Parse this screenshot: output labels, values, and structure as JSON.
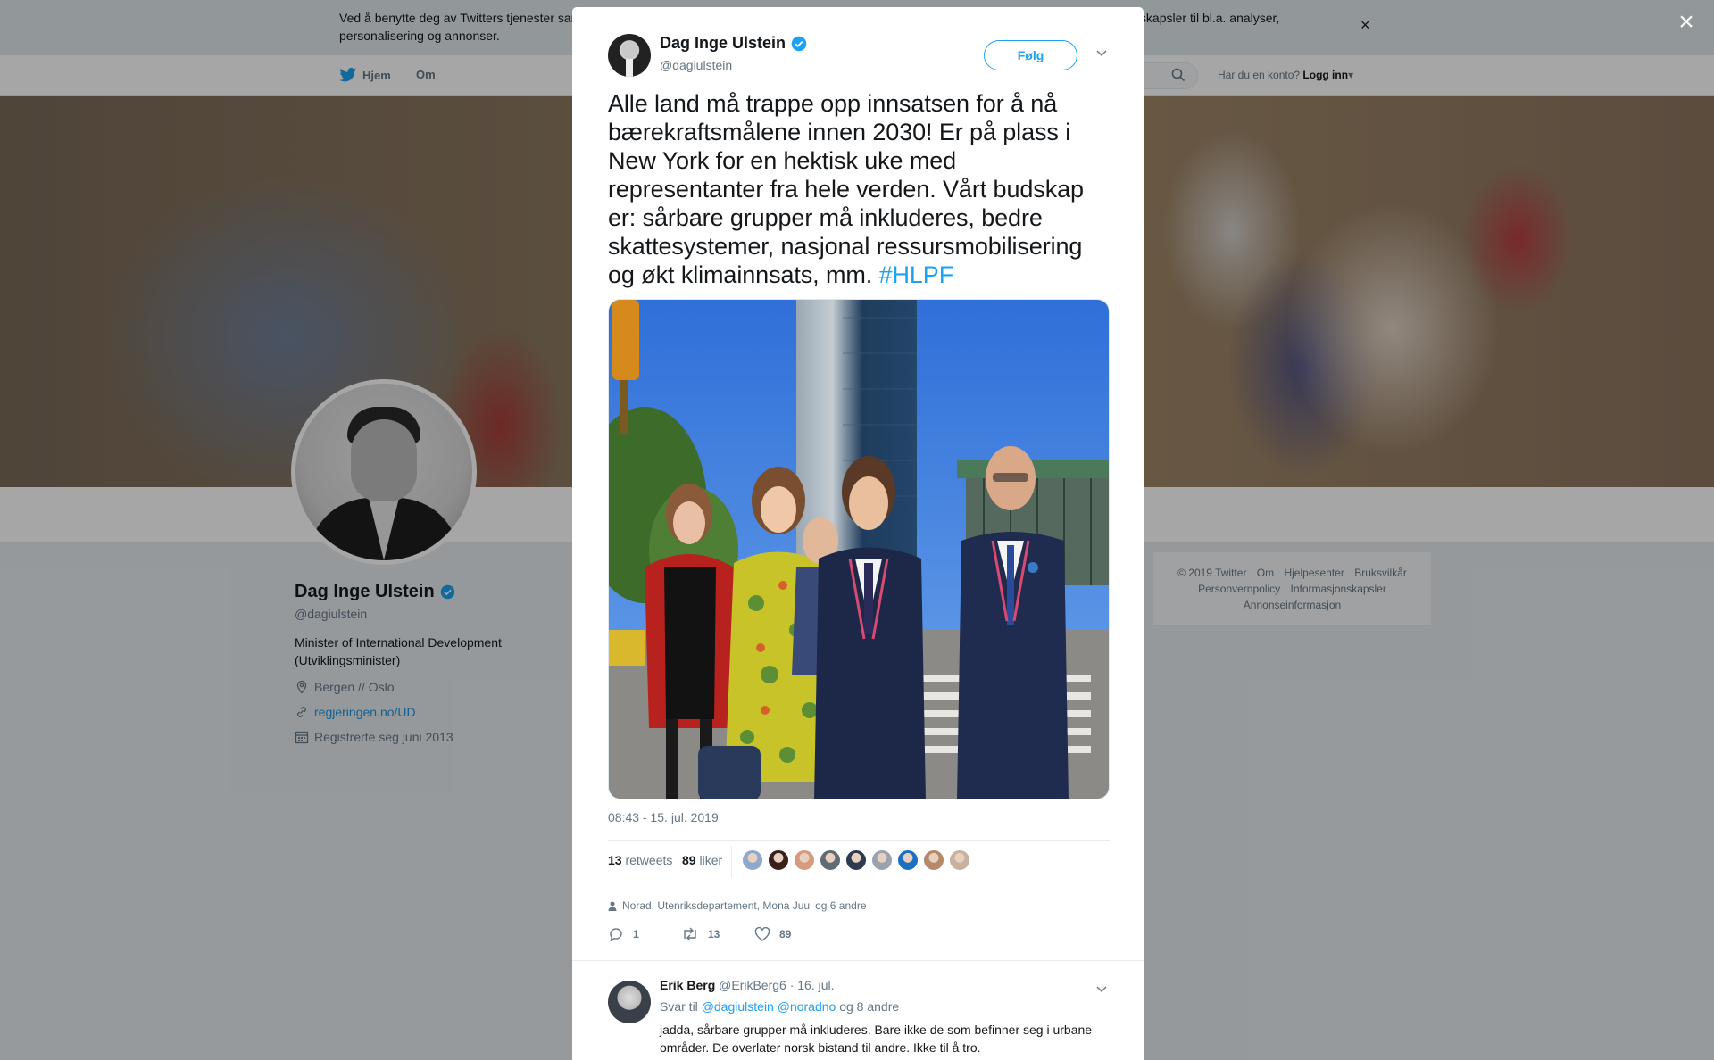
{
  "cookie_banner": {
    "text": "Ved å benytte deg av Twitters tjenester samtykker du til vår bruk av informasjonskapsler og at vi samler inn og bruker informasjon fra informasjonskapsler til bl.a. analyser, personalisering og annonser.",
    "close_glyph": "×"
  },
  "nav": {
    "home_label": "Hjem",
    "about_label": "Om",
    "account_prompt": "Har du en konto?",
    "login_label": "Logg inn"
  },
  "profile": {
    "name": "Dag Inge Ulstein",
    "handle": "@dagiulstein",
    "bio": "Minister of International Development (Utviklingsminister)",
    "location": "Bergen // Oslo",
    "link": "regjeringen.no/UD",
    "joined": "Registrerte seg juni 2013"
  },
  "footer": {
    "links": [
      "© 2019 Twitter",
      "Om",
      "Hjelpesenter",
      "Bruksvilkår",
      "Personvernpolicy",
      "Informasjonskapsler",
      "Annonseinformasjon"
    ]
  },
  "overlay": {
    "close_glyph": "×"
  },
  "tweet": {
    "author_name": "Dag Inge Ulstein",
    "author_handle": "@dagiulstein",
    "follow_label": "Følg",
    "text": "Alle land må trappe opp innsatsen for å nå bærekraftsmålene innen 2030! Er på plass i New York for en hektisk uke med representanter fra hele verden. Vårt budskap er: sårbare grupper må inkluderes, bedre skattesystemer, nasjonal ressursmobilisering og økt klimainnsats, mm.",
    "hashtag": "#HLPF",
    "timestamp": "08:43 - 15. jul. 2019",
    "retweets_count": "13",
    "retweets_label": "retweets",
    "likes_count": "89",
    "likes_label": "liker",
    "liked_by": "Norad, Utenriksdepartement, Mona Juul og 6 andre",
    "actions": {
      "reply_count": "1",
      "retweet_count": "13",
      "like_count": "89"
    },
    "liker_colors": [
      "#8ea9c9",
      "#3b1f1a",
      "#d79a7e",
      "#5f6b75",
      "#2d3b4e",
      "#9aa3ad",
      "#1d6fc2",
      "#b48a6a",
      "#c7b2a0"
    ]
  },
  "reply": {
    "name": "Erik Berg",
    "handle": "@ErikBerg6",
    "date": "· 16. jul.",
    "reply_prefix": "Svar til",
    "mention_1": "@dagiulstein",
    "mention_2": "@noradno",
    "reply_suffix": "og 8 andre",
    "text": "jadda, sårbare grupper må inkluderes. Bare ikke de som befinner seg i urbane områder. De overlater norsk bistand til andre. Ikke til å tro."
  },
  "colors": {
    "accent": "#1da1f2",
    "verified": "#1da1f2",
    "muted": "#657786"
  }
}
